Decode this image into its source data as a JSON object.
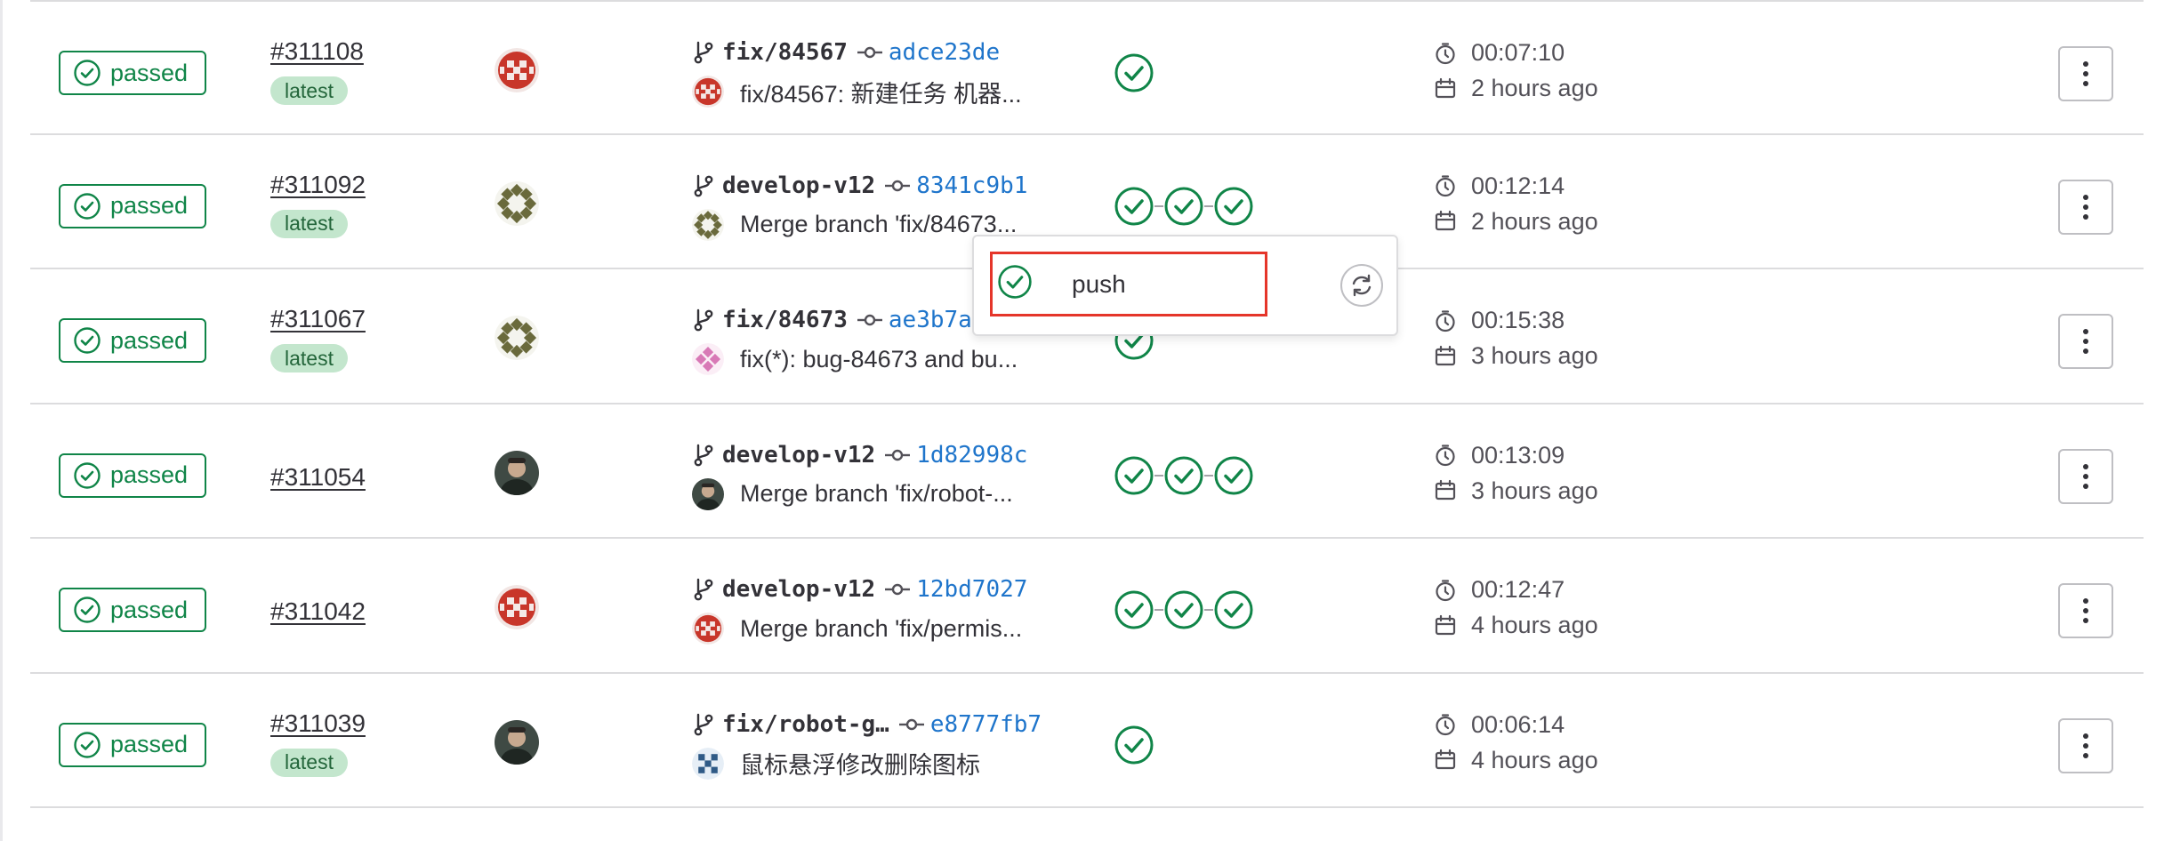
{
  "colors": {
    "success": "#108548",
    "latest_bg": "#c3e6cd",
    "latest_text": "#24663b",
    "link_blue": "#1f75cb",
    "highlight_red": "#e5352a"
  },
  "rows": [
    {
      "status": "passed",
      "id": "#311108",
      "latest": "latest",
      "avatar": "red-identicon",
      "ref": "fix/84567",
      "sha": "adce23de",
      "message": "fix/84567: 新建任务 机器...",
      "stages": [
        "passed"
      ],
      "duration": "00:07:10",
      "finished": "2 hours ago"
    },
    {
      "status": "passed",
      "id": "#311092",
      "latest": "latest",
      "avatar": "olive-ring-identicon",
      "ref": "develop-v12",
      "sha": "8341c9b1",
      "message": "Merge branch 'fix/84673...",
      "stages": [
        "passed",
        "passed",
        "passed"
      ],
      "duration": "00:12:14",
      "finished": "2 hours ago"
    },
    {
      "status": "passed",
      "id": "#311067",
      "latest": "latest",
      "avatar": "olive-ring-identicon",
      "ref": "fix/84673",
      "sha": "ae3b7a",
      "message": "fix(*): bug-84673 and bu...",
      "stages": [
        "passed"
      ],
      "duration": "00:15:38",
      "finished": "3 hours ago",
      "mini_avatar": "pink-identicon"
    },
    {
      "status": "passed",
      "id": "#311054",
      "latest": null,
      "avatar": "photo-avatar",
      "ref": "develop-v12",
      "sha": "1d82998c",
      "message": "Merge branch 'fix/robot-...",
      "stages": [
        "passed",
        "passed",
        "passed"
      ],
      "duration": "00:13:09",
      "finished": "3 hours ago"
    },
    {
      "status": "passed",
      "id": "#311042",
      "latest": null,
      "avatar": "red-identicon",
      "ref": "develop-v12",
      "sha": "12bd7027",
      "message": "Merge branch 'fix/permis...",
      "stages": [
        "passed",
        "passed",
        "passed"
      ],
      "duration": "00:12:47",
      "finished": "4 hours ago"
    },
    {
      "status": "passed",
      "id": "#311039",
      "latest": "latest",
      "avatar": "photo-avatar",
      "ref": "fix/robot-g…",
      "sha": "e8777fb7",
      "message": "鼠标悬浮修改删除图标",
      "stages": [
        "passed"
      ],
      "duration": "00:06:14",
      "finished": "4 hours ago",
      "mini_avatar": "blue-identicon"
    }
  ],
  "popover": {
    "job_name": "push",
    "status_icon": "check-circle-icon",
    "retry_icon": "retry-icon"
  }
}
